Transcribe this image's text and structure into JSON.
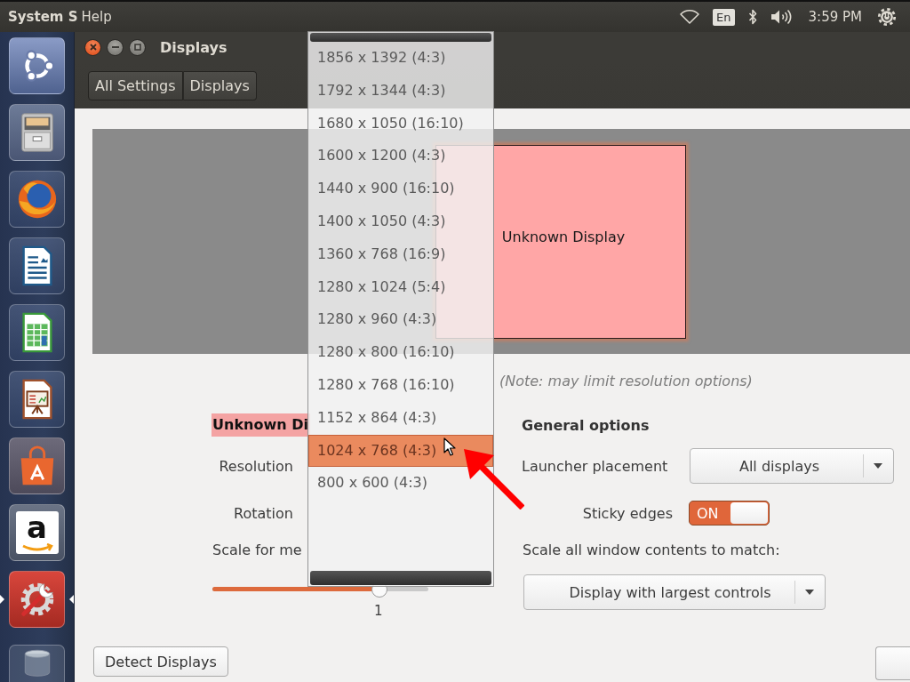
{
  "top_panel": {
    "app_title": "System S",
    "menus": [
      "Help"
    ],
    "keyboard_layout": "En",
    "clock": "3:59 PM"
  },
  "launcher": [
    {
      "kind": "dash",
      "running": false,
      "focused": false
    },
    {
      "kind": "files",
      "running": false,
      "focused": false
    },
    {
      "kind": "browser",
      "running": false,
      "focused": false
    },
    {
      "kind": "writer",
      "running": false,
      "focused": false
    },
    {
      "kind": "calc",
      "running": false,
      "focused": false
    },
    {
      "kind": "impress",
      "running": false,
      "focused": false
    },
    {
      "kind": "store",
      "running": false,
      "focused": false
    },
    {
      "kind": "amazon",
      "glyph": "a",
      "running": false,
      "focused": false
    },
    {
      "kind": "settings",
      "running": true,
      "focused": true
    },
    {
      "kind": "trash",
      "running": false,
      "focused": false
    }
  ],
  "window": {
    "title": "Displays",
    "breadcrumb": [
      "All Settings",
      "Displays"
    ]
  },
  "preview": {
    "monitors": [
      {
        "label": "Unknown Display"
      }
    ]
  },
  "note": "(Note: may limit resolution options)",
  "display": {
    "title": "Unknown Di",
    "resolution_label": "Resolution",
    "rotation_label": "Rotation",
    "scale_label": "Scale for me",
    "scale": {
      "level": 0.77,
      "reading": "1"
    }
  },
  "general_options": {
    "title": "General options",
    "launcher_placement": {
      "label": "Launcher placement",
      "value": "All displays"
    },
    "sticky_edges": {
      "label": "Sticky edges",
      "on": true,
      "state_text": "ON"
    },
    "scale_all": {
      "label": "Scale all window contents to match:",
      "value": "Display with largest controls"
    }
  },
  "resolution_menu": {
    "items": [
      {
        "label": "1856 x 1392 (4:3)",
        "selected": false
      },
      {
        "label": "1792 x 1344 (4:3)",
        "selected": false
      },
      {
        "label": "1680 x 1050 (16:10)",
        "selected": false
      },
      {
        "label": "1600 x 1200 (4:3)",
        "selected": false
      },
      {
        "label": "1440 x 900 (16:10)",
        "selected": false
      },
      {
        "label": "1400 x 1050 (4:3)",
        "selected": false
      },
      {
        "label": "1360 x 768 (16:9)",
        "selected": false
      },
      {
        "label": "1280 x 1024 (5:4)",
        "selected": false
      },
      {
        "label": "1280 x 960 (4:3)",
        "selected": false
      },
      {
        "label": "1280 x 800 (16:10)",
        "selected": false
      },
      {
        "label": "1280 x 768 (16:10)",
        "selected": false
      },
      {
        "label": "1152 x 864 (4:3)",
        "selected": false
      },
      {
        "label": "1024 x 768 (4:3)",
        "selected": true
      },
      {
        "label": "800 x 600 (4:3)",
        "selected": false
      }
    ]
  },
  "detect_button": "Detect Displays"
}
